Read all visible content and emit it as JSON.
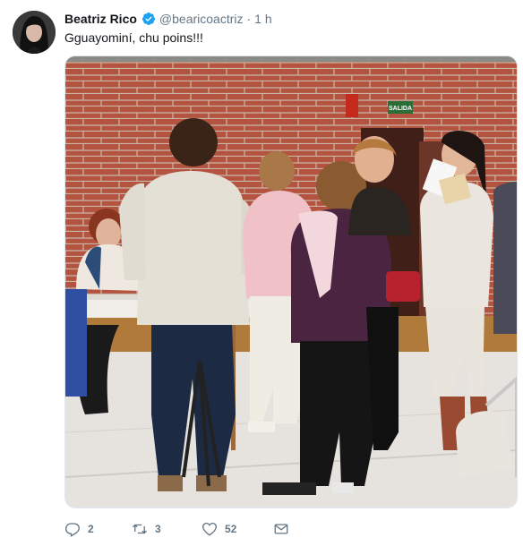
{
  "tweet": {
    "author_name": "Beatriz Rico",
    "handle": "@bearicoactriz",
    "separator": "·",
    "time": "1 h",
    "text": "Gguayominí, chu poins!!!",
    "photo": {
      "signs": {
        "exit": "SALIDA"
      }
    },
    "actions": {
      "reply_count": "2",
      "retweet_count": "3",
      "like_count": "52"
    },
    "icons": {
      "avatar": "profile-avatar",
      "verified": "verified-badge-icon",
      "reply": "reply-icon",
      "retweet": "retweet-icon",
      "like": "heart-icon",
      "dm": "envelope-icon"
    },
    "colors": {
      "accent": "#1da1f2",
      "muted": "#657786",
      "text": "#14171a",
      "brick": "#b4533f"
    }
  }
}
